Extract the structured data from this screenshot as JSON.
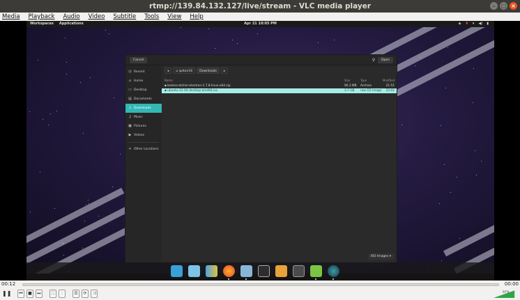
{
  "window": {
    "title": "rtmp://139.84.132.127/live/stream - VLC media player"
  },
  "menubar": [
    "Media",
    "Playback",
    "Audio",
    "Video",
    "Subtitle",
    "Tools",
    "View",
    "Help"
  ],
  "desktop": {
    "topbar": {
      "left": [
        "Workspaces",
        "Applications"
      ],
      "clock": "Apr 21  10:05 PM"
    },
    "dialog": {
      "cancel_label": "Cancel",
      "open_label": "Open",
      "breadcrumb": [
        "spiton16",
        "Downloads"
      ],
      "sidebar": [
        {
          "icon": "clock-icon",
          "glyph": "◷",
          "label": "Recent"
        },
        {
          "icon": "home-icon",
          "glyph": "⌂",
          "label": "Home"
        },
        {
          "icon": "desktop-icon",
          "glyph": "▭",
          "label": "Desktop"
        },
        {
          "icon": "document-icon",
          "glyph": "▤",
          "label": "Documents"
        },
        {
          "icon": "download-icon",
          "glyph": "↓",
          "label": "Downloads"
        },
        {
          "icon": "music-icon",
          "glyph": "♫",
          "label": "Music"
        },
        {
          "icon": "picture-icon",
          "glyph": "▣",
          "label": "Pictures"
        },
        {
          "icon": "video-icon",
          "glyph": "▶",
          "label": "Videos"
        },
        {
          "icon": "plus-icon",
          "glyph": "+",
          "label": "Other Locations"
        }
      ],
      "columns": {
        "name": "Name",
        "size": "Size",
        "type": "Type",
        "modified": "Modified"
      },
      "files": [
        {
          "name": "balena-etcher-electron-1.7.8-linux-x64.zip",
          "size": "90.3 MB",
          "type": "Archive",
          "modified": "21:51",
          "selected": false
        },
        {
          "name": "ubuntu-22.04-desktop-amd64.iso",
          "size": "3.7 GB",
          "type": "raw CD image",
          "modified": "22:02",
          "selected": true
        }
      ],
      "filter_label": "ISO Images ▾"
    },
    "dock_icons": [
      "tiles-icon",
      "calendar-icon",
      "app-grid-icon",
      "firefox-icon",
      "files-icon",
      "terminal-icon",
      "software-icon",
      "settings-icon",
      "cube-app-icon",
      "globe-app-icon"
    ]
  },
  "controls": {
    "time_current": "00:12",
    "time_total": "00:00",
    "volume": "97%",
    "volume_level": 0.97
  },
  "colors": {
    "accent": "#33b8b5",
    "selection": "#a7ece6",
    "vlc_orange": "#e95420"
  }
}
